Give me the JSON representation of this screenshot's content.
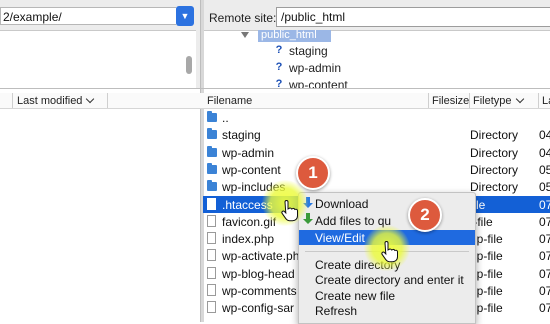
{
  "local": {
    "path_value": "2/example/"
  },
  "remote": {
    "label": "Remote site:",
    "path_value": "/public_html",
    "tree": {
      "selected": "public_html",
      "items": [
        "staging",
        "wp-admin",
        "wp-content"
      ]
    }
  },
  "local_columns": {
    "last_modified": "Last modified"
  },
  "remote_columns": {
    "filename": "Filename",
    "filesize": "Filesize",
    "filetype": "Filetype",
    "last_mod_partial": "La"
  },
  "files": [
    {
      "name": "..",
      "type": "",
      "mod": "",
      "kind": "folder"
    },
    {
      "name": "staging",
      "type": "Directory",
      "mod": "04",
      "kind": "folder"
    },
    {
      "name": "wp-admin",
      "type": "Directory",
      "mod": "04",
      "kind": "folder"
    },
    {
      "name": "wp-content",
      "type": "Directory",
      "mod": "05",
      "kind": "folder"
    },
    {
      "name": "wp-includes",
      "type": "Directory",
      "mod": "05",
      "kind": "folder"
    },
    {
      "name": ".htaccess",
      "type": "file",
      "mod": "07",
      "kind": "file",
      "selected": true
    },
    {
      "name": "favicon.gif",
      "type": "f-file",
      "mod": "07",
      "kind": "file"
    },
    {
      "name": "index.php",
      "type": "hp-file",
      "mod": "07",
      "kind": "file"
    },
    {
      "name": "wp-activate.ph",
      "type": "hp-file",
      "mod": "07",
      "kind": "file"
    },
    {
      "name": "wp-blog-head",
      "type": "hp-file",
      "mod": "07",
      "kind": "file"
    },
    {
      "name": "wp-comments",
      "type": "hp-file",
      "mod": "07",
      "kind": "file"
    },
    {
      "name": "wp-config-sar",
      "type": "hp-file",
      "mod": "07",
      "kind": "file"
    }
  ],
  "context_menu": {
    "download": "Download",
    "add_files": "Add files to qu",
    "view_edit": "View/Edit",
    "create_directory": "Create directory",
    "create_directory_enter": "Create directory and enter it",
    "create_new_file": "Create new file",
    "refresh": "Refresh"
  },
  "callouts": {
    "one": "1",
    "two": "2"
  },
  "colors": {
    "selection": "#1360d6",
    "menu_highlight": "#1f6ae0",
    "badge": "#dd5a3d",
    "glow": "#f0ff3c"
  }
}
